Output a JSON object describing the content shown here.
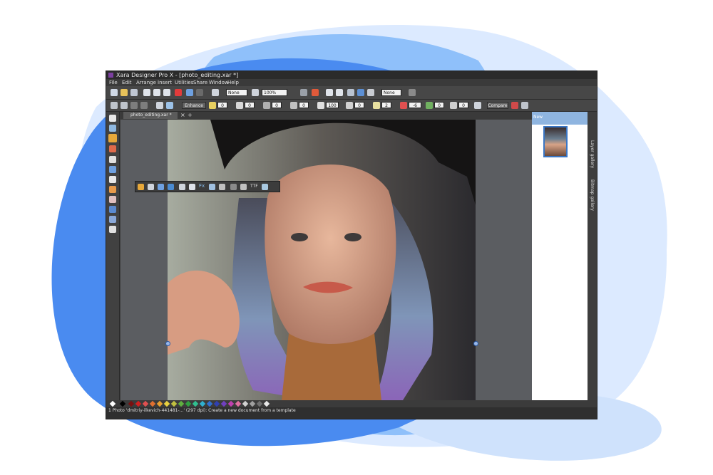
{
  "window": {
    "title": "Xara Designer Pro X - [photo_editing.xar *]"
  },
  "menu": [
    "File",
    "Edit",
    "Arrange",
    "Insert",
    "Utilities",
    "Share",
    "Window",
    "Help"
  ],
  "toolbar1": {
    "line_style": "None",
    "zoom": "100%",
    "quality": "None"
  },
  "toolbar2": {
    "enhance_label": "Enhance",
    "compare_label": "Compare",
    "values": [
      "0",
      "0",
      "0",
      "0",
      "100",
      "0",
      "2",
      "-6",
      "0",
      "0"
    ]
  },
  "document_tab": "photo_editing.xar *",
  "context_toolbar": {
    "fx_label": "Fx",
    "ttf_label": "TTF"
  },
  "gallery": {
    "new_label": "New"
  },
  "right_tabs": [
    "Layer gallery",
    "Bitmap gallery"
  ],
  "status": "1 Photo 'dmitriy-ilkevich-441481-...' (297 dpi): Create a new document from a template",
  "colors": {
    "blob_dark": "#4a8bf0",
    "blob_light": "#8fc0fa",
    "blob_pale": "#dceaff",
    "ui_dark": "#3d3d3d",
    "selection_blue": "#3a76c4"
  }
}
